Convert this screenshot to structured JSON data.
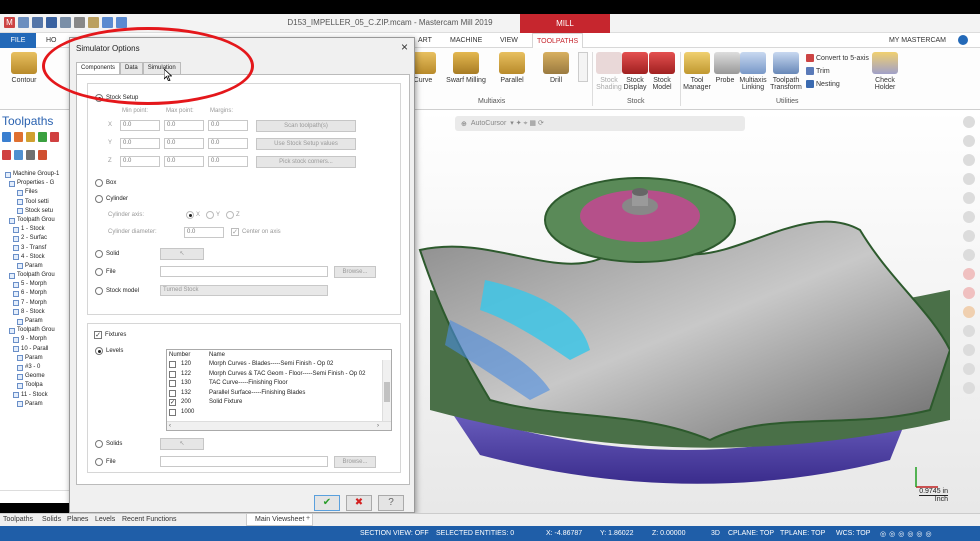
{
  "window": {
    "title": "D153_IMPELLER_05_C.ZIP.mcam - Mastercam Mill 2019",
    "context_tab": "MILL"
  },
  "ribbon": {
    "tabs": [
      "FILE",
      "HO",
      "ART",
      "MACHINE",
      "VIEW",
      "TOOLPATHS"
    ],
    "active_tab": "TOOLPATHS",
    "account": "MY MASTERCAM",
    "buttons": {
      "contour": "Contour",
      "curve": "Curve",
      "swarf": "Swarf Milling",
      "parallel": "Parallel",
      "drill": "Drill",
      "stock_shading": "Stock Shading",
      "stock_display": "Stock Display",
      "stock_model": "Stock Model",
      "tool_manager": "Tool Manager",
      "probe": "Probe",
      "multiaxis_linking": "Multiaxis Linking",
      "toolpath_transform": "Toolpath Transform",
      "convert_5axis": "Convert to 5-axis",
      "trim": "Trim",
      "nesting": "Nesting",
      "check_holder": "Check Holder"
    },
    "groups": {
      "multiaxis": "Multiaxis",
      "stock": "Stock",
      "utilities": "Utilities"
    }
  },
  "left_pane": {
    "title": "Toolpaths",
    "tree": [
      "Machine Group-1",
      "Properties - G",
      "Files",
      "Tool setti",
      "Stock setu",
      "Toolpath Grou",
      "1 - Stock",
      "2 - Surfac",
      "3 - Transf",
      "4 - Stock",
      "Param",
      "Toolpath Grou",
      "5 - Morph",
      "6 - Morph",
      "7 - Morph",
      "8 - Stock",
      "Param",
      "Toolpath Grou",
      "9 - Morph",
      "10 - Parall",
      "Param",
      "#3 - 0",
      "Geome",
      "Toolpa",
      "11 - Stock",
      "Param"
    ]
  },
  "viewport": {
    "autocursor": "AutoCursor",
    "scale_value": "0.9745 in",
    "scale_unit": "Inch"
  },
  "dialog": {
    "title": "Simulator Options",
    "close": "×",
    "tabs": [
      "Components",
      "Data",
      "Simulation"
    ],
    "stock": {
      "stock_setup": "Stock Setup",
      "col_min": "Min point:",
      "col_max": "Max point:",
      "col_margins": "Margins:",
      "rows": [
        {
          "axis": "X",
          "min": "0.0",
          "max": "0.0",
          "margin": "0.0"
        },
        {
          "axis": "Y",
          "min": "0.0",
          "max": "0.0",
          "margin": "0.0"
        },
        {
          "axis": "Z",
          "min": "0.0",
          "max": "0.0",
          "margin": "0.0"
        }
      ],
      "btn_scan": "Scan toolpath(s)",
      "btn_use_setup": "Use Stock Setup values",
      "btn_pick": "Pick stock corners...",
      "box": "Box",
      "cylinder": "Cylinder",
      "cyl_axis": "Cylinder axis:",
      "axis_x": "X",
      "axis_y": "Y",
      "axis_z": "Z",
      "cyl_diameter": "Cylinder diameter:",
      "cyl_diameter_val": "0.0",
      "center_on_axis": "Center on axis",
      "solid": "Solid",
      "file": "File",
      "browse": "Browse...",
      "stock_model": "Stock model",
      "stock_model_val": "Turned Stock"
    },
    "fixtures": {
      "label": "Fixtures",
      "levels": "Levels",
      "col_number": "Number",
      "col_name": "Name",
      "rows": [
        {
          "num": "120",
          "name": "Morph Curves - Blades-----Semi Finish - Op 02",
          "checked": false
        },
        {
          "num": "122",
          "name": "Morph Curves & TAC Geom - Floor-----Semi Finish - Op 02",
          "checked": false
        },
        {
          "num": "130",
          "name": "TAC Curve-----Finishing Floor",
          "checked": false
        },
        {
          "num": "132",
          "name": "Parallel Surface-----Finishing Blades",
          "checked": false
        },
        {
          "num": "200",
          "name": "Solid Fixture",
          "checked": true
        },
        {
          "num": "1000",
          "name": "",
          "checked": false
        }
      ],
      "solids": "Solids",
      "file": "File",
      "browse": "Browse..."
    },
    "ok": "✔",
    "cancel": "✖",
    "help": "?"
  },
  "bottom_tabs": [
    "Toolpaths",
    "Solids",
    "Planes",
    "Levels",
    "Recent Functions"
  ],
  "viewsheet": "Main Viewsheet",
  "status": {
    "section_view": "SECTION VIEW: OFF",
    "selected": "SELECTED ENTITIES: 0",
    "x": "X: -4.86787",
    "y": "Y: 1.86022",
    "z": "Z: 0.00000",
    "mode": "3D",
    "cplane": "CPLANE: TOP",
    "tplane": "TPLANE: TOP",
    "wcs": "WCS: TOP"
  },
  "colors": {
    "accent_red": "#c6262e",
    "file_blue": "#2369b8",
    "status_blue": "#1f5ea8",
    "annotation_red": "#e4171b"
  }
}
